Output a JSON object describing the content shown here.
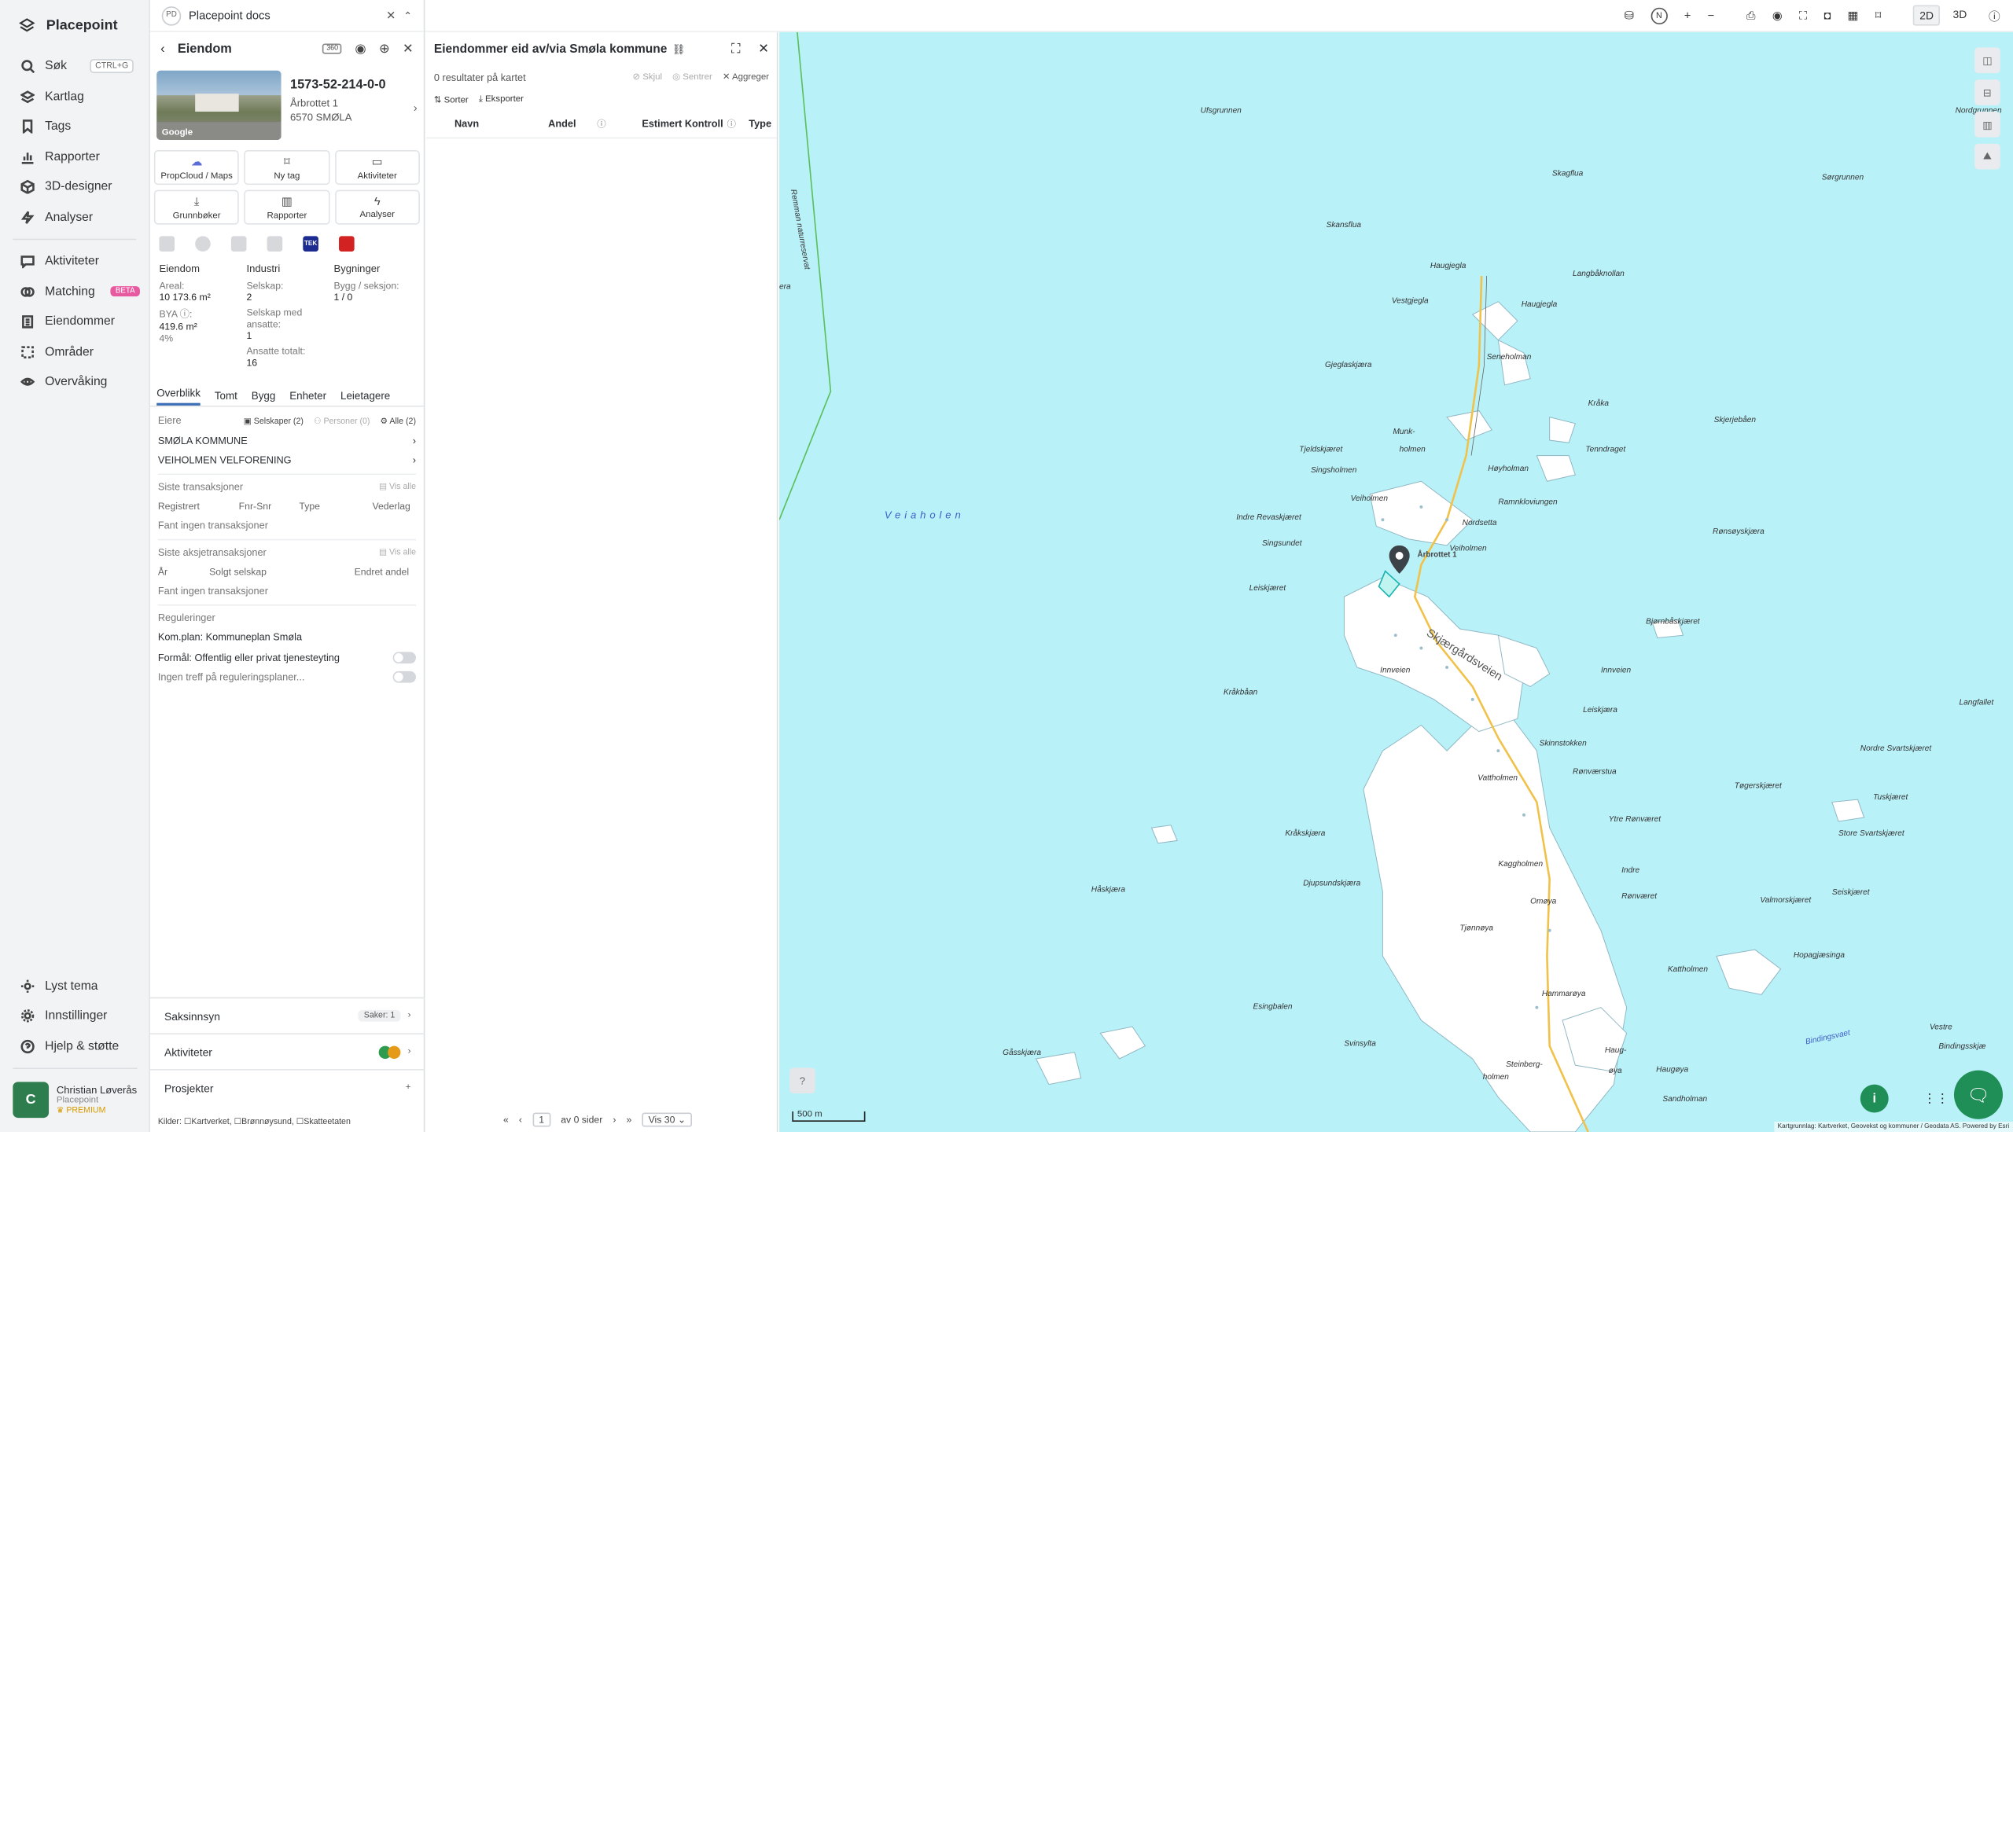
{
  "nav": {
    "brand": "Placepoint",
    "items": [
      {
        "label": "Søk",
        "icon": "search-icon",
        "kbd": "CTRL+G"
      },
      {
        "label": "Kartlag",
        "icon": "layers-icon"
      },
      {
        "label": "Tags",
        "icon": "bookmark-icon"
      },
      {
        "label": "Rapporter",
        "icon": "chart-icon"
      },
      {
        "label": "3D-designer",
        "icon": "cube-icon"
      },
      {
        "label": "Analyser",
        "icon": "bolt-icon"
      }
    ],
    "items2": [
      {
        "label": "Aktiviteter",
        "icon": "chat-icon"
      },
      {
        "label": "Matching",
        "icon": "matching-icon",
        "badge": "BETA"
      },
      {
        "label": "Eiendommer",
        "icon": "building-icon"
      },
      {
        "label": "Områder",
        "icon": "area-icon"
      },
      {
        "label": "Overvåking",
        "icon": "eye-icon"
      }
    ],
    "bottom": [
      {
        "label": "Lyst tema",
        "icon": "sun-icon"
      },
      {
        "label": "Innstillinger",
        "icon": "gear-icon"
      },
      {
        "label": "Hjelp & støtte",
        "icon": "help-icon"
      }
    ],
    "user": {
      "initial": "C",
      "name": "Christian Løverås",
      "org": "Placepoint",
      "plan": "PREMIUM"
    }
  },
  "docbar": {
    "badge": "PD",
    "title": "Placepoint docs"
  },
  "property": {
    "header": "Eiendom",
    "badge360": "360",
    "id": "1573-52-214-0-0",
    "address1": "Årbrottet 1",
    "address2": "6570 SMØLA",
    "photo_credit": "Google",
    "buttons": [
      "PropCloud / Maps",
      "Ny tag",
      "Aktiviteter",
      "Grunnbøker",
      "Rapporter",
      "Analyser"
    ],
    "tek_label": "TEK",
    "facts": {
      "col1_title": "Eiendom",
      "areal_label": "Areal:",
      "areal_value": "10 173.6 m²",
      "bya_label": "BYA ⓘ:",
      "bya_value": "419.6 m²",
      "bya_pct": "4%",
      "col2_title": "Industri",
      "selskap_label": "Selskap:",
      "selskap_value": "2",
      "med_ansatte_label": "Selskap med ansatte:",
      "med_ansatte_value": "1",
      "ansatte_label": "Ansatte totalt:",
      "ansatte_value": "16",
      "col3_title": "Bygninger",
      "bygg_label": "Bygg / seksjon:",
      "bygg_value": "1 / 0"
    },
    "tabs": [
      "Overblikk",
      "Tomt",
      "Bygg",
      "Enheter",
      "Leietagere"
    ],
    "owners_label": "Eiere",
    "owners_chips": {
      "selskaper": "Selskaper (2)",
      "personer": "Personer (0)",
      "alle": "Alle (2)"
    },
    "owners": [
      "SMØLA KOMMUNE",
      "VEIHOLMEN VELFORENING"
    ],
    "tx_title": "Siste transaksjoner",
    "vis_alle": "Vis alle",
    "tx_cols": [
      "Registrert",
      "Fnr-Snr",
      "Type",
      "Vederlag"
    ],
    "tx_empty": "Fant ingen transaksjoner",
    "aksje_title": "Siste aksjetransaksjoner",
    "aksje_cols": [
      "År",
      "Solgt selskap",
      "Endret andel"
    ],
    "aksje_empty": "Fant ingen transaksjoner",
    "reg_title": "Reguleringer",
    "reg_plan": "Kom.plan: Kommuneplan Smøla",
    "reg_formal": "Formål: Offentlig eller privat tjenesteyting",
    "reg_none": "Ingen treff på reguleringsplaner...",
    "acc": {
      "saksinnsyn": "Saksinnsyn",
      "saker": "Saker: 1",
      "aktiviteter": "Aktiviteter",
      "prosjekter": "Prosjekter"
    },
    "sources": "Kilder: ☐Kartverket, ☐Brønnøysund, ☐Skatteetaten"
  },
  "results": {
    "title": "Eiendommer eid av/via Smøla kommune",
    "count": "0 resultater på kartet",
    "actions": [
      "Skjul",
      "Sentrer",
      "Aggreger"
    ],
    "tools": [
      "Sorter",
      "Eksporter"
    ],
    "cols": [
      "Navn",
      "Andel",
      "Estimert Kontroll",
      "Type"
    ],
    "pager": {
      "page": "1",
      "of": "av 0 sider",
      "vis": "Vis 30"
    }
  },
  "topbar": {
    "compass": "N",
    "mode2d": "2D",
    "mode3d": "3D"
  },
  "map": {
    "scale": "500 m",
    "attribution": "Kartgrunnlag: Kartverket, Geovekst og kommuner / Geodata AS. Powered by Esri",
    "water_label": "Veiaholen",
    "pin_label": "Årbrottet 1",
    "reserve_label": "Remman naturreservat",
    "labels": [
      {
        "t": "Ufsgrunnen"
      },
      {
        "t": "Nordgrunnen"
      },
      {
        "t": "Skagflua"
      },
      {
        "t": "Sørgrunnen"
      },
      {
        "t": "Skansflua"
      },
      {
        "t": "Haugjegla"
      },
      {
        "t": "Langbåknollan"
      },
      {
        "t": "Vestgjegla"
      },
      {
        "t": "Haugjegla"
      },
      {
        "t": "Seneholman"
      },
      {
        "t": "Gjeglaskjæra"
      },
      {
        "t": "Kråka"
      },
      {
        "t": "Skjerjebåen"
      },
      {
        "t": "Munk-"
      },
      {
        "t": "holmen"
      },
      {
        "t": "Tjeldskjæret"
      },
      {
        "t": "Tenndraget"
      },
      {
        "t": "Singsholmen"
      },
      {
        "t": "Høyholman"
      },
      {
        "t": "Veiholmen"
      },
      {
        "t": "Ramnkloviungen"
      },
      {
        "t": "Indre Revaskjæret"
      },
      {
        "t": "Nordsetta"
      },
      {
        "t": "Rønsøyskjæra"
      },
      {
        "t": "Singsundet"
      },
      {
        "t": "Veiholmen"
      },
      {
        "t": "Leiskjæret"
      },
      {
        "t": "Bjørnbåskjæret"
      },
      {
        "t": "Skjærgårdsveien"
      },
      {
        "t": "Innveien"
      },
      {
        "t": "Innveien"
      },
      {
        "t": "Kråkbåan"
      },
      {
        "t": "Langfallet"
      },
      {
        "t": "Leiskjæra"
      },
      {
        "t": "Skinnstokken"
      },
      {
        "t": "Nordre Svartskjæret"
      },
      {
        "t": "Vattholmen"
      },
      {
        "t": "Rønværstua"
      },
      {
        "t": "Tøgerskjæret"
      },
      {
        "t": "Tuskjæret"
      },
      {
        "t": "Ytre Rønværet"
      },
      {
        "t": "Store Svartskjæret"
      },
      {
        "t": "Kråkskjæra"
      },
      {
        "t": "Kaggholmen"
      },
      {
        "t": "Indre"
      },
      {
        "t": "Djupsundskjæra"
      },
      {
        "t": "Håskjæra"
      },
      {
        "t": "Rønværet"
      },
      {
        "t": "Seiskjæret"
      },
      {
        "t": "Omøya"
      },
      {
        "t": "Valmorskjæret"
      },
      {
        "t": "Tjønnøya"
      },
      {
        "t": "Hopagjæsinga"
      },
      {
        "t": "Kattholmen"
      },
      {
        "t": "Hammarøya"
      },
      {
        "t": "Esingbalen"
      },
      {
        "t": "Bindingsvaet"
      },
      {
        "t": "Vestre"
      },
      {
        "t": "Bindingsskjæ"
      },
      {
        "t": "Gåsskjæra"
      },
      {
        "t": "Svinsylta"
      },
      {
        "t": "Haug-"
      },
      {
        "t": "øya"
      },
      {
        "t": "Haugøya"
      },
      {
        "t": "Steinberg-"
      },
      {
        "t": "holmen"
      },
      {
        "t": "Sandholman"
      },
      {
        "t": "era"
      }
    ]
  }
}
